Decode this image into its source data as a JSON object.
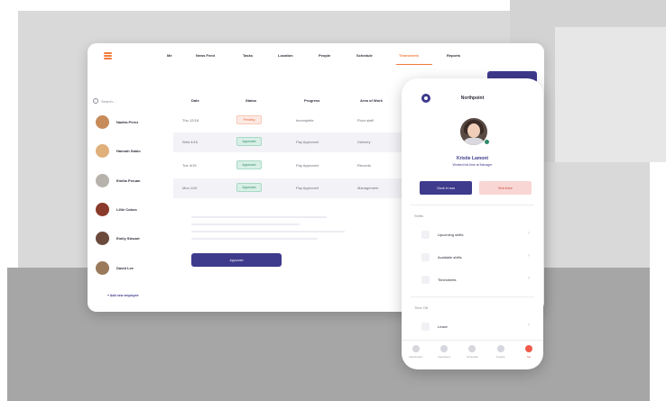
{
  "desktop": {
    "nav": {
      "items": [
        {
          "label": "Me"
        },
        {
          "label": "News Feed"
        },
        {
          "label": "Tasks"
        },
        {
          "label": "Location"
        },
        {
          "label": "People"
        },
        {
          "label": "Schedule"
        },
        {
          "label": "Timesheets"
        },
        {
          "label": "Reports"
        }
      ],
      "active_index": 6
    },
    "search": {
      "placeholder": "Search..."
    },
    "employees": [
      {
        "name": "Nadira Perez"
      },
      {
        "name": "Hannah Sabio"
      },
      {
        "name": "Emilia Peruan"
      },
      {
        "name": "Lillie Cobos"
      },
      {
        "name": "Emily Steuart"
      },
      {
        "name": "David Lee"
      }
    ],
    "add_employee": "+ Add new employee",
    "table": {
      "headers": [
        "Date",
        "Status",
        "Progress",
        "Area of Work"
      ],
      "rows": [
        {
          "date": "Thu 12/18",
          "status": "Pending",
          "progress": "Incomplete",
          "area": "Floor staff"
        },
        {
          "date": "Wed 4/16",
          "status": "Approved",
          "progress": "Pay Approved",
          "area": "Delivery"
        },
        {
          "date": "Tue 4/15",
          "status": "Approved",
          "progress": "Pay Approved",
          "area": "Records"
        },
        {
          "date": "Mon 11/5",
          "status": "Approved",
          "progress": "Pay Approved",
          "area": "Management"
        }
      ]
    },
    "approve_button": "Approved"
  },
  "phone": {
    "brand": "Northpoint",
    "profile": {
      "name": "Kristie Lamont",
      "role": "Worked full-time at Manager"
    },
    "buttons": {
      "primary": "Clock In now",
      "secondary": "Sick leave"
    },
    "sections": [
      {
        "title": "Shifts",
        "items": [
          {
            "label": "Upcoming shifts"
          },
          {
            "label": "Available shifts"
          },
          {
            "label": "Timesheets"
          }
        ]
      },
      {
        "title": "Time Off",
        "items": [
          {
            "label": "Leave"
          }
        ]
      }
    ],
    "tabs": [
      {
        "label": "Dashboard"
      },
      {
        "label": "Newsfeed"
      },
      {
        "label": "Schedule"
      },
      {
        "label": "People"
      },
      {
        "label": "Me"
      }
    ],
    "active_tab": 4
  },
  "colors": {
    "brand_purple": "#3e3a8c",
    "accent_orange": "#f07a3a",
    "approved_green": "#2d8a65",
    "pending_orange": "#d96a3a"
  }
}
